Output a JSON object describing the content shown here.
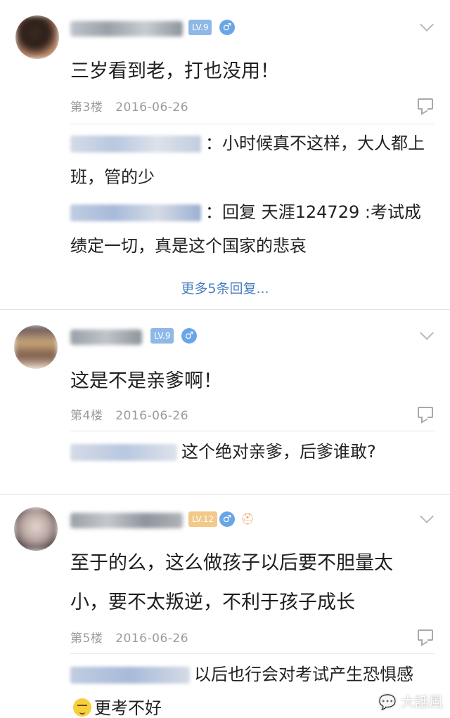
{
  "comments": [
    {
      "level": "LV.9",
      "gender_icon": "male-icon",
      "text": "三岁看到老，打也没用！",
      "floor": "第3楼",
      "date": "2016-06-26",
      "replies": [
        {
          "text": "：小时候真不这样，大人都上班，管的少"
        },
        {
          "text": "：回复 天涯124729 :考试成绩定一切，真是这个国家的悲哀"
        }
      ],
      "more_replies": "更多5条回复..."
    },
    {
      "level": "LV.9",
      "gender_icon": "male-icon",
      "text": "这是不是亲爹啊！",
      "floor": "第4楼",
      "date": "2016-06-26",
      "replies": [
        {
          "text": "这个绝对亲爹，后爹谁敢?"
        }
      ]
    },
    {
      "level": "LV.12",
      "gender_icon": "male-icon",
      "extra_icon": "hat-icon",
      "text": "至于的么，这么做孩子以后要不胆量太小，要不太叛逆，不利于孩子成长",
      "floor": "第5楼",
      "date": "2016-06-26",
      "replies": [
        {
          "text_before": "以后也行会对考试产生恐惧感",
          "emoji": "sweat-emoji",
          "text_after": "更考不好"
        }
      ]
    }
  ],
  "colors": {
    "badge_blue": "#8fb8e8",
    "badge_gold": "#f3c98a",
    "link_blue": "#4a7fc0",
    "meta_gray": "#9a9a9a"
  },
  "watermark": "大話風"
}
